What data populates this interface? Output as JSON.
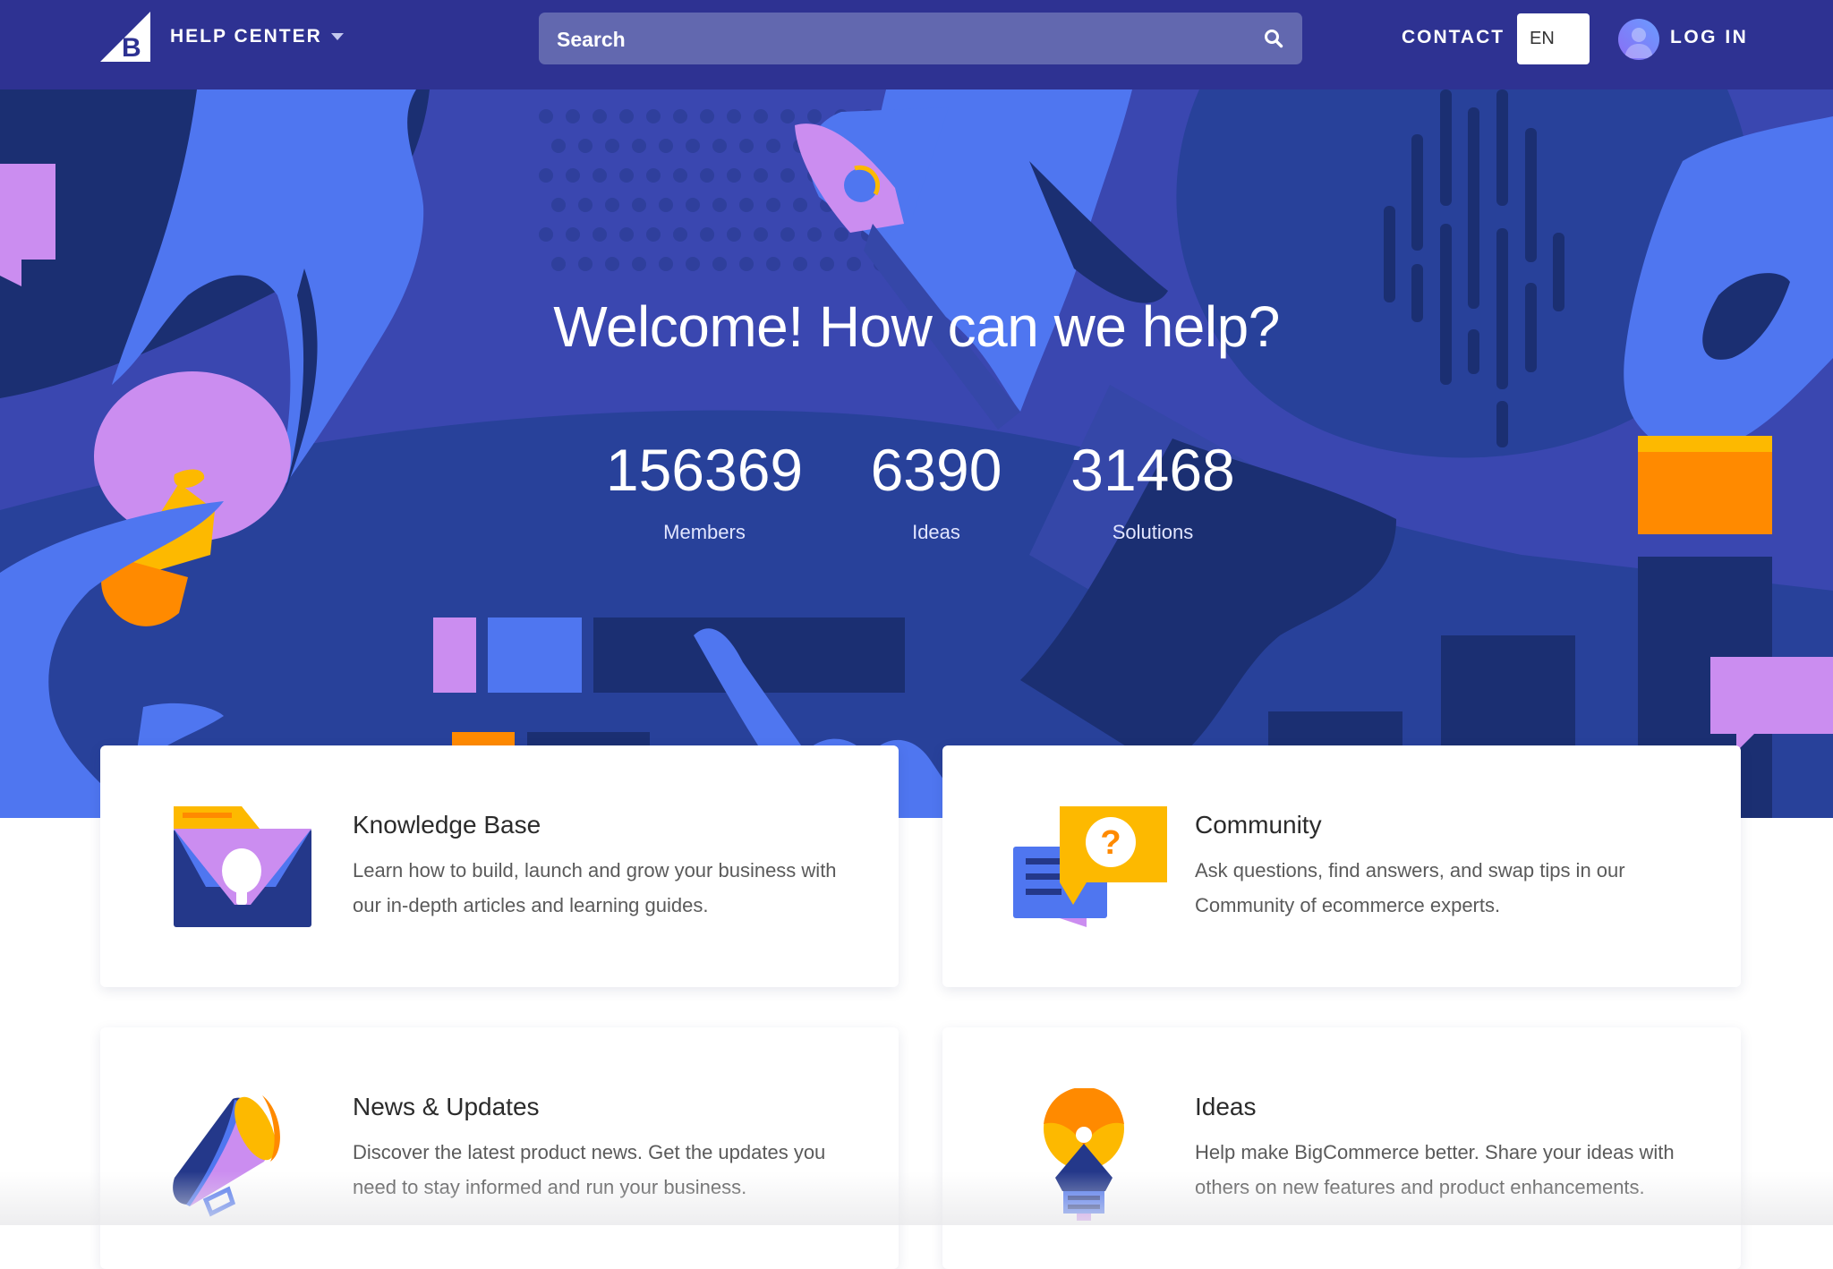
{
  "header": {
    "brand_section": "HELP CENTER",
    "search_placeholder": "Search",
    "contact_label": "CONTACT",
    "language": "EN",
    "login_label": "LOG IN"
  },
  "hero": {
    "title": "Welcome! How can we help?",
    "stats": [
      {
        "value": "156369",
        "label": "Members"
      },
      {
        "value": "6390",
        "label": "Ideas"
      },
      {
        "value": "31468",
        "label": "Solutions"
      }
    ]
  },
  "cards": [
    {
      "icon": "folder-lightbulb-icon",
      "title": "Knowledge Base",
      "description": "Learn how to build, launch and grow your business with our in-depth articles and learning guides."
    },
    {
      "icon": "chat-question-icon",
      "title": "Community",
      "description": "Ask questions, find answers, and swap tips in our Community of ecommerce experts."
    },
    {
      "icon": "megaphone-icon",
      "title": "News & Updates",
      "description": "Discover the latest product news. Get the updates you need to stay informed and run your business."
    },
    {
      "icon": "lightbulb-icon",
      "title": "Ideas",
      "description": "Help make BigCommerce better. Share your ideas with others on new features and product enhancements."
    }
  ],
  "colors": {
    "header_bg": "#2e3292",
    "hero_bg": "#3a47b0",
    "hero_navy": "#1b2f72",
    "hand_blue": "#4f76f0",
    "lilac": "#cb8df0",
    "yellow": "#fdb900",
    "orange": "#ff8a00"
  }
}
